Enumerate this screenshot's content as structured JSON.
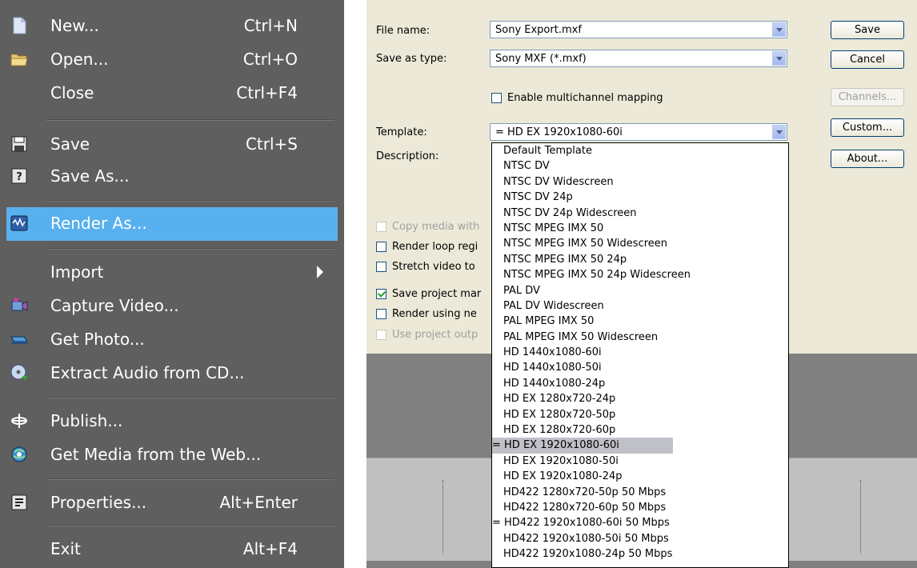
{
  "file_menu": {
    "items": [
      {
        "label": "New...",
        "shortcut": "Ctrl+N",
        "icon": "new-file-icon"
      },
      {
        "label": "Open...",
        "shortcut": "Ctrl+O",
        "icon": "folder-open-icon"
      },
      {
        "label": "Close",
        "shortcut": "Ctrl+F4"
      },
      {
        "label": "Save",
        "shortcut": "Ctrl+S",
        "icon": "floppy-disk-icon"
      },
      {
        "label": "Save As...",
        "shortcut": "",
        "icon": "save-as-icon"
      },
      {
        "label": "Render As...",
        "shortcut": "",
        "icon": "render-icon"
      },
      {
        "label": "Import",
        "shortcut": "",
        "submenu": true
      },
      {
        "label": "Capture Video...",
        "shortcut": "",
        "icon": "capture-camera-icon"
      },
      {
        "label": "Get Photo...",
        "shortcut": "",
        "icon": "scanner-icon"
      },
      {
        "label": "Extract Audio from CD...",
        "shortcut": "",
        "icon": "cd-extract-icon"
      },
      {
        "label": "Publish...",
        "shortcut": "",
        "icon": "publish-globe-icon"
      },
      {
        "label": "Get Media from the Web...",
        "shortcut": "",
        "icon": "web-media-icon"
      },
      {
        "label": "Properties...",
        "shortcut": "Alt+Enter",
        "icon": "properties-icon"
      },
      {
        "label": "Exit",
        "shortcut": "Alt+F4"
      }
    ],
    "highlight_color": "#58b0ee",
    "background_color": "#5f5f5f"
  },
  "dialog": {
    "file_name_label": "File name:",
    "file_name_value": "Sony Export.mxf",
    "save_as_type_label": "Save as type:",
    "save_as_type_value": "Sony MXF (*.mxf)",
    "multichannel_label": "Enable multichannel mapping",
    "template_label": "Template:",
    "template_value": "= HD EX 1920x1080-60i",
    "description_label": "Description:",
    "buttons": {
      "save": "Save",
      "cancel": "Cancel",
      "channels": "Channels...",
      "custom": "Custom...",
      "about": "About..."
    },
    "options": [
      {
        "label": "Copy media with",
        "checked": false,
        "enabled": false
      },
      {
        "label": "Render loop regi",
        "checked": false,
        "enabled": true
      },
      {
        "label": "Stretch video to",
        "checked": false,
        "enabled": true
      },
      {
        "label": "Save project mar",
        "checked": true,
        "enabled": true
      },
      {
        "label": "Render using ne",
        "checked": false,
        "enabled": true
      },
      {
        "label": "Use project outp",
        "checked": false,
        "enabled": false
      }
    ],
    "template_list": [
      "Default Template",
      "NTSC DV",
      "NTSC DV Widescreen",
      "NTSC DV 24p",
      "NTSC DV 24p Widescreen",
      "NTSC MPEG IMX 50",
      "NTSC MPEG IMX 50 Widescreen",
      "NTSC MPEG IMX 50 24p",
      "NTSC MPEG IMX 50 24p Widescreen",
      "PAL DV",
      "PAL DV Widescreen",
      "PAL MPEG IMX 50",
      "PAL MPEG IMX 50 Widescreen",
      "HD 1440x1080-60i",
      "HD 1440x1080-50i",
      "HD 1440x1080-24p",
      "HD EX 1280x720-24p",
      "HD EX 1280x720-50p",
      "HD EX 1280x720-60p",
      "= HD EX 1920x1080-60i",
      "HD EX 1920x1080-50i",
      "HD EX 1920x1080-24p",
      "HD422 1280x720-50p 50 Mbps",
      "HD422 1280x720-60p 50 Mbps",
      "= HD422 1920x1080-60i 50 Mbps",
      "HD422 1920x1080-50i 50 Mbps",
      "HD422 1920x1080-24p 50 Mbps"
    ],
    "selected_template_index": 19
  }
}
